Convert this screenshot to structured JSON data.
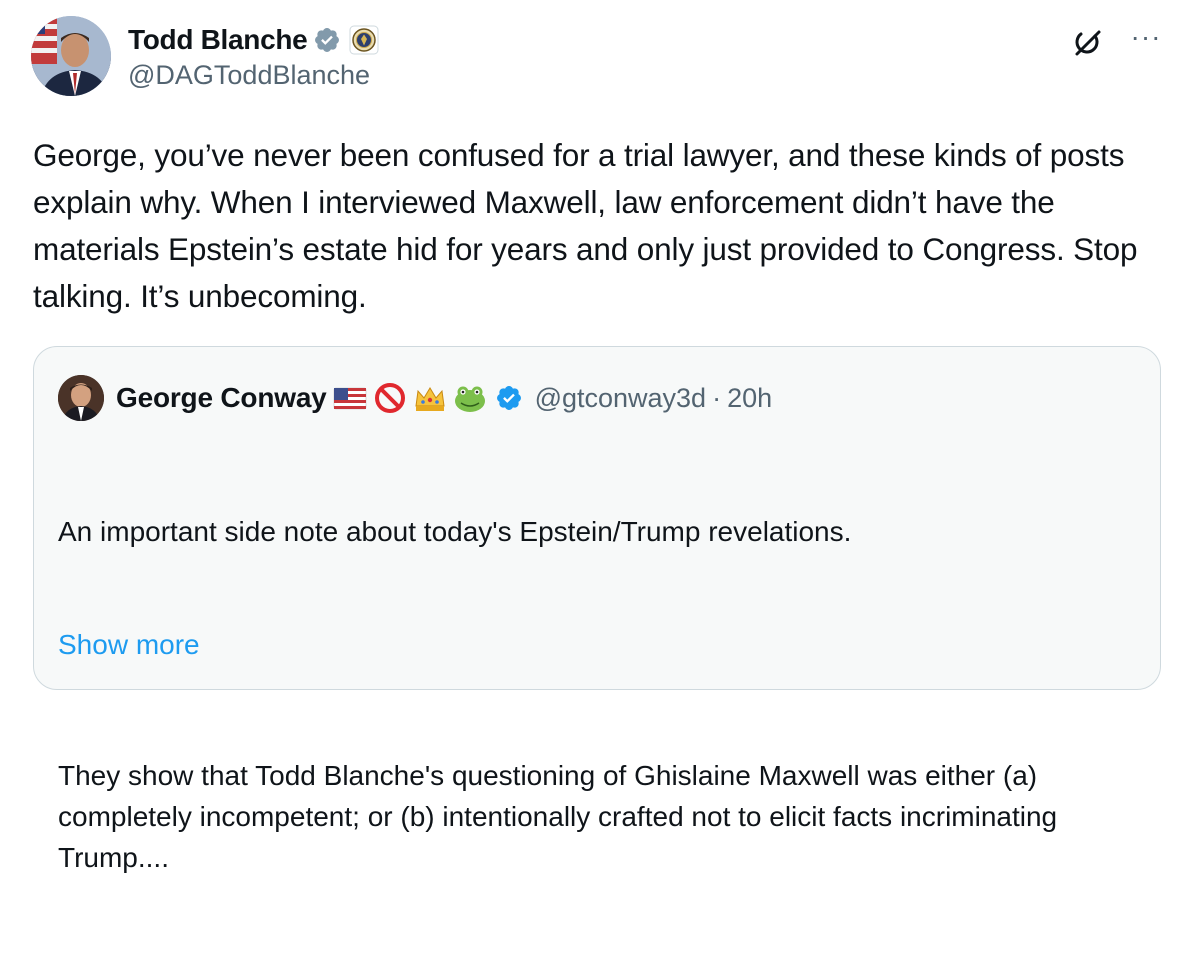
{
  "tweet": {
    "author": {
      "display_name": "Todd Blanche",
      "handle": "@DAGToddBlanche",
      "verified_badge": "verified-gray-icon",
      "affiliation_badge": "doj-seal-icon"
    },
    "actions": {
      "grok_icon": "grok-icon",
      "more_label": "···"
    },
    "text": "George, you’ve never been confused for a trial lawyer, and these kinds of posts explain why. When I interviewed Maxwell, law enforcement didn’t have the materials Epstein’s estate hid for years and only just provided to Congress. Stop talking. It’s unbecoming."
  },
  "quote": {
    "author": {
      "display_name": "George Conway",
      "emoji": [
        "us-flag-emoji",
        "prohibited-emoji",
        "crown-emoji",
        "frog-emoji"
      ],
      "verified_badge": "verified-blue-icon",
      "handle": "@gtconway3d",
      "separator": "·",
      "time": "20h"
    },
    "paragraph_1": "An important side note about today's Epstein/Trump revelations.",
    "paragraph_2": "They show that Todd Blanche's questioning of Ghislaine Maxwell was either (a) completely incompetent; or (b) intentionally crafted not to elicit facts incriminating Trump....",
    "show_more": "Show more"
  },
  "colors": {
    "text": "#0f1419",
    "secondary": "#536471",
    "link": "#1d9bf0",
    "quote_border": "#cfd9de",
    "quote_bg": "#f7f9f9",
    "verified_gray": "#829aab",
    "verified_blue": "#1d9bf0"
  }
}
